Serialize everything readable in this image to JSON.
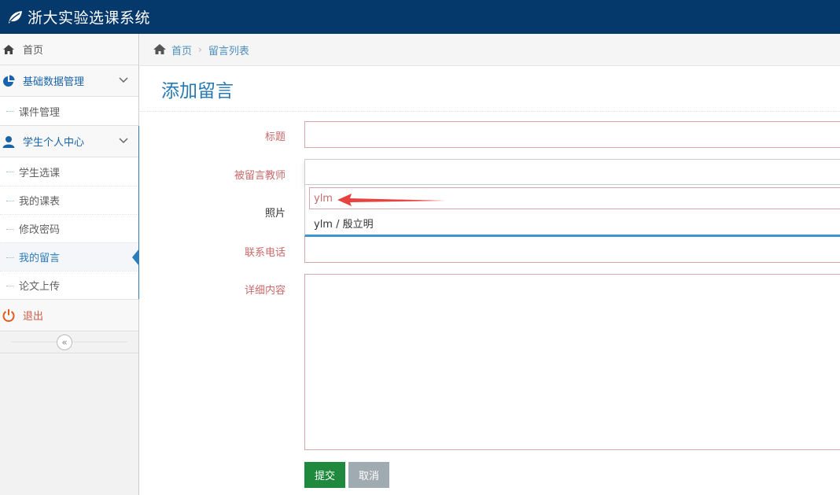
{
  "app": {
    "title": "浙大实验选课系统"
  },
  "sidebar": {
    "home": "首页",
    "basic_data": {
      "label": "基础数据管理",
      "items": [
        "课件管理"
      ]
    },
    "student_center": {
      "label": "学生个人中心",
      "items": [
        "学生选课",
        "我的课表",
        "修改密码",
        "我的留言",
        "论文上传"
      ],
      "active": "我的留言"
    },
    "logout": "退出",
    "collapse_symbol": "«"
  },
  "breadcrumb": {
    "home": "首页",
    "current": "留言列表"
  },
  "page": {
    "title": "添加留言"
  },
  "form": {
    "title_label": "标题",
    "teacher_label": "被留言教师",
    "photo_label": "照片",
    "phone_label": "联系电话",
    "content_label": "详细内容",
    "teacher_search_value": "ylm",
    "teacher_option": "ylm / 殷立明",
    "submit": "提交",
    "cancel": "取消"
  },
  "colors": {
    "navbar": "#05386b",
    "accent": "#2b7dbc",
    "label": "#c86a6a",
    "submit": "#1f8a3d",
    "cancel": "#a0aab1",
    "annotation_arrow": "#e8423f"
  }
}
